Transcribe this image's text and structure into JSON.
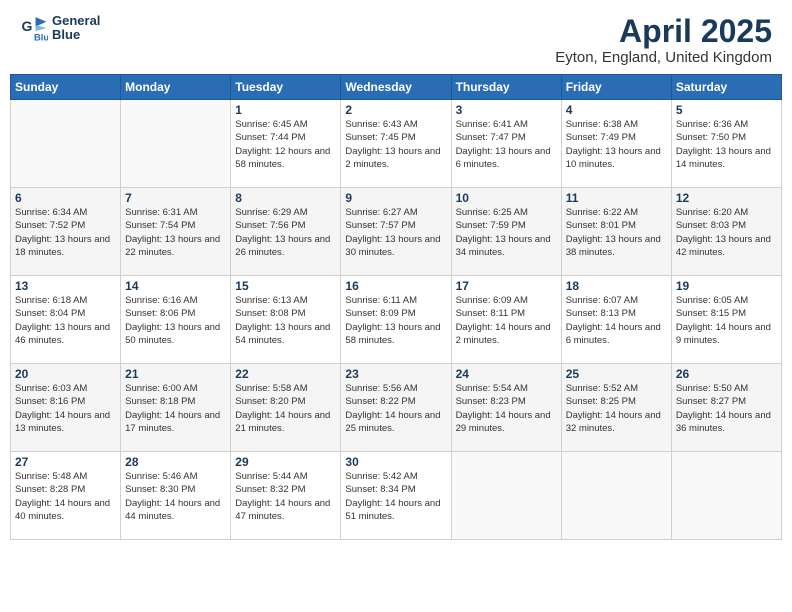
{
  "header": {
    "logo_line1": "General",
    "logo_line2": "Blue",
    "month": "April 2025",
    "location": "Eyton, England, United Kingdom"
  },
  "weekdays": [
    "Sunday",
    "Monday",
    "Tuesday",
    "Wednesday",
    "Thursday",
    "Friday",
    "Saturday"
  ],
  "weeks": [
    [
      {
        "day": "",
        "info": ""
      },
      {
        "day": "",
        "info": ""
      },
      {
        "day": "1",
        "info": "Sunrise: 6:45 AM\nSunset: 7:44 PM\nDaylight: 12 hours and 58 minutes."
      },
      {
        "day": "2",
        "info": "Sunrise: 6:43 AM\nSunset: 7:45 PM\nDaylight: 13 hours and 2 minutes."
      },
      {
        "day": "3",
        "info": "Sunrise: 6:41 AM\nSunset: 7:47 PM\nDaylight: 13 hours and 6 minutes."
      },
      {
        "day": "4",
        "info": "Sunrise: 6:38 AM\nSunset: 7:49 PM\nDaylight: 13 hours and 10 minutes."
      },
      {
        "day": "5",
        "info": "Sunrise: 6:36 AM\nSunset: 7:50 PM\nDaylight: 13 hours and 14 minutes."
      }
    ],
    [
      {
        "day": "6",
        "info": "Sunrise: 6:34 AM\nSunset: 7:52 PM\nDaylight: 13 hours and 18 minutes."
      },
      {
        "day": "7",
        "info": "Sunrise: 6:31 AM\nSunset: 7:54 PM\nDaylight: 13 hours and 22 minutes."
      },
      {
        "day": "8",
        "info": "Sunrise: 6:29 AM\nSunset: 7:56 PM\nDaylight: 13 hours and 26 minutes."
      },
      {
        "day": "9",
        "info": "Sunrise: 6:27 AM\nSunset: 7:57 PM\nDaylight: 13 hours and 30 minutes."
      },
      {
        "day": "10",
        "info": "Sunrise: 6:25 AM\nSunset: 7:59 PM\nDaylight: 13 hours and 34 minutes."
      },
      {
        "day": "11",
        "info": "Sunrise: 6:22 AM\nSunset: 8:01 PM\nDaylight: 13 hours and 38 minutes."
      },
      {
        "day": "12",
        "info": "Sunrise: 6:20 AM\nSunset: 8:03 PM\nDaylight: 13 hours and 42 minutes."
      }
    ],
    [
      {
        "day": "13",
        "info": "Sunrise: 6:18 AM\nSunset: 8:04 PM\nDaylight: 13 hours and 46 minutes."
      },
      {
        "day": "14",
        "info": "Sunrise: 6:16 AM\nSunset: 8:06 PM\nDaylight: 13 hours and 50 minutes."
      },
      {
        "day": "15",
        "info": "Sunrise: 6:13 AM\nSunset: 8:08 PM\nDaylight: 13 hours and 54 minutes."
      },
      {
        "day": "16",
        "info": "Sunrise: 6:11 AM\nSunset: 8:09 PM\nDaylight: 13 hours and 58 minutes."
      },
      {
        "day": "17",
        "info": "Sunrise: 6:09 AM\nSunset: 8:11 PM\nDaylight: 14 hours and 2 minutes."
      },
      {
        "day": "18",
        "info": "Sunrise: 6:07 AM\nSunset: 8:13 PM\nDaylight: 14 hours and 6 minutes."
      },
      {
        "day": "19",
        "info": "Sunrise: 6:05 AM\nSunset: 8:15 PM\nDaylight: 14 hours and 9 minutes."
      }
    ],
    [
      {
        "day": "20",
        "info": "Sunrise: 6:03 AM\nSunset: 8:16 PM\nDaylight: 14 hours and 13 minutes."
      },
      {
        "day": "21",
        "info": "Sunrise: 6:00 AM\nSunset: 8:18 PM\nDaylight: 14 hours and 17 minutes."
      },
      {
        "day": "22",
        "info": "Sunrise: 5:58 AM\nSunset: 8:20 PM\nDaylight: 14 hours and 21 minutes."
      },
      {
        "day": "23",
        "info": "Sunrise: 5:56 AM\nSunset: 8:22 PM\nDaylight: 14 hours and 25 minutes."
      },
      {
        "day": "24",
        "info": "Sunrise: 5:54 AM\nSunset: 8:23 PM\nDaylight: 14 hours and 29 minutes."
      },
      {
        "day": "25",
        "info": "Sunrise: 5:52 AM\nSunset: 8:25 PM\nDaylight: 14 hours and 32 minutes."
      },
      {
        "day": "26",
        "info": "Sunrise: 5:50 AM\nSunset: 8:27 PM\nDaylight: 14 hours and 36 minutes."
      }
    ],
    [
      {
        "day": "27",
        "info": "Sunrise: 5:48 AM\nSunset: 8:28 PM\nDaylight: 14 hours and 40 minutes."
      },
      {
        "day": "28",
        "info": "Sunrise: 5:46 AM\nSunset: 8:30 PM\nDaylight: 14 hours and 44 minutes."
      },
      {
        "day": "29",
        "info": "Sunrise: 5:44 AM\nSunset: 8:32 PM\nDaylight: 14 hours and 47 minutes."
      },
      {
        "day": "30",
        "info": "Sunrise: 5:42 AM\nSunset: 8:34 PM\nDaylight: 14 hours and 51 minutes."
      },
      {
        "day": "",
        "info": ""
      },
      {
        "day": "",
        "info": ""
      },
      {
        "day": "",
        "info": ""
      }
    ]
  ]
}
